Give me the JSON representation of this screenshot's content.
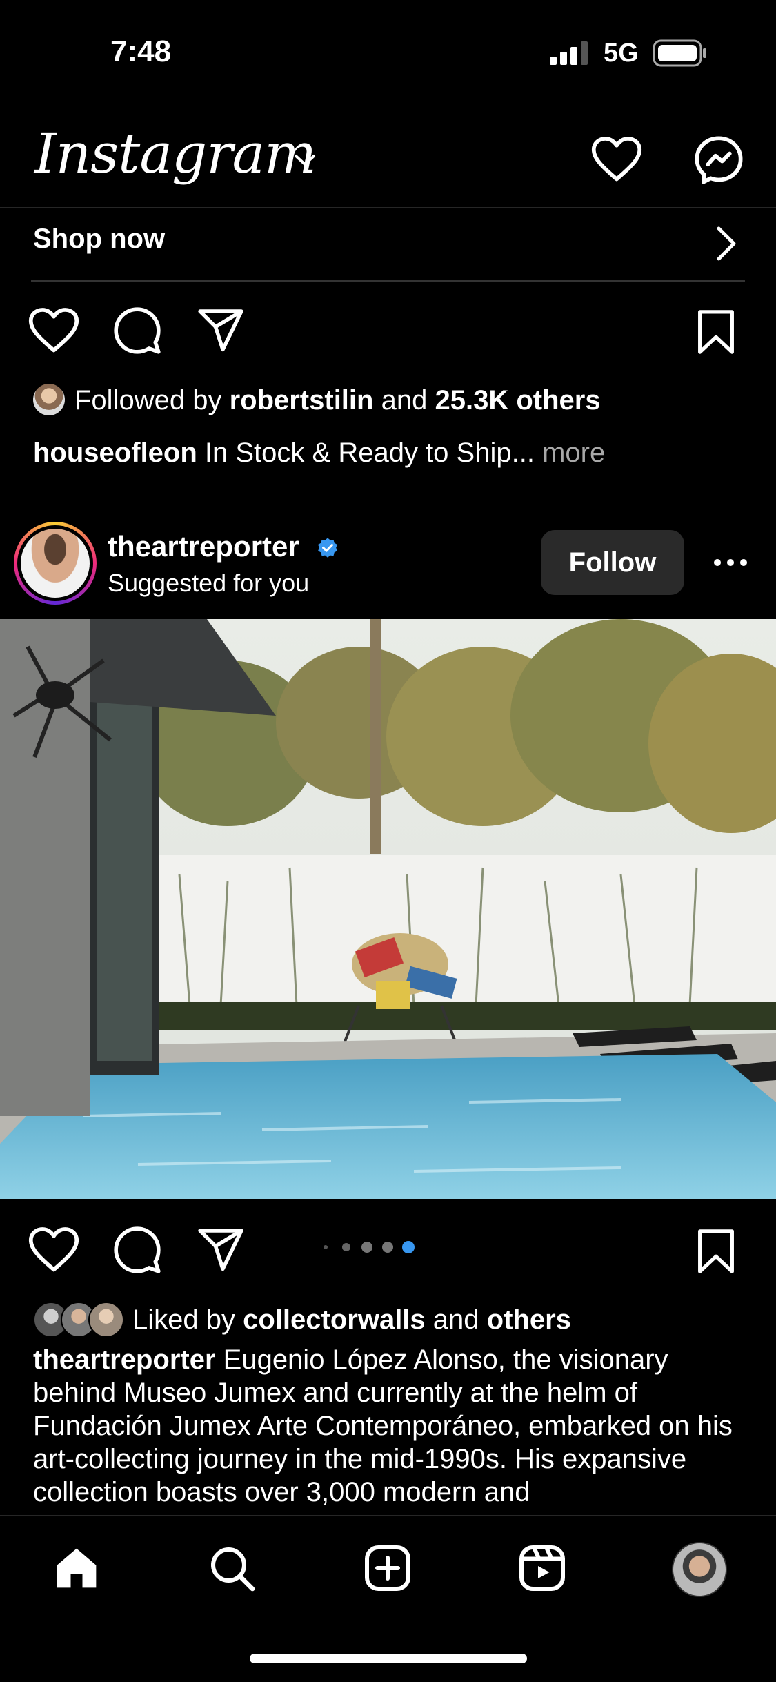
{
  "status_bar": {
    "time": "7:48",
    "network": "5G"
  },
  "header": {
    "logo": "Instagram"
  },
  "ad_post": {
    "shop_now": "Shop now",
    "followed_by_prefix": "Followed by",
    "followed_by_user": "robertstilin",
    "followed_by_joiner": "and",
    "followed_by_count": "25.3K others",
    "caption_user": "houseofleon",
    "caption_text": "In Stock & Ready to Ship...",
    "more": "more"
  },
  "post": {
    "username": "theartreporter",
    "subtitle": "Suggested for you",
    "follow_label": "Follow",
    "carousel": {
      "count": 5,
      "active": 4
    },
    "liked_prefix": "Liked by",
    "liked_user": "collectorwalls",
    "liked_joiner": "and",
    "liked_others": "others",
    "caption_user": "theartreporter",
    "caption_text": "Eugenio López Alonso, the visionary behind Museo Jumex and currently at the helm of Fundación Jumex Arte Contemporáneo, embarked on his art-collecting journey in the mid-1990s. His expansive collection boasts over 3,000 modern and"
  },
  "colors": {
    "background": "#000000",
    "verified": "#3897f0",
    "follow_button": "#2a2a2a",
    "muted_text": "#a8a8a8"
  },
  "nav": {
    "items": [
      "home-icon",
      "search-icon",
      "create-icon",
      "reels-icon",
      "profile-avatar"
    ]
  }
}
